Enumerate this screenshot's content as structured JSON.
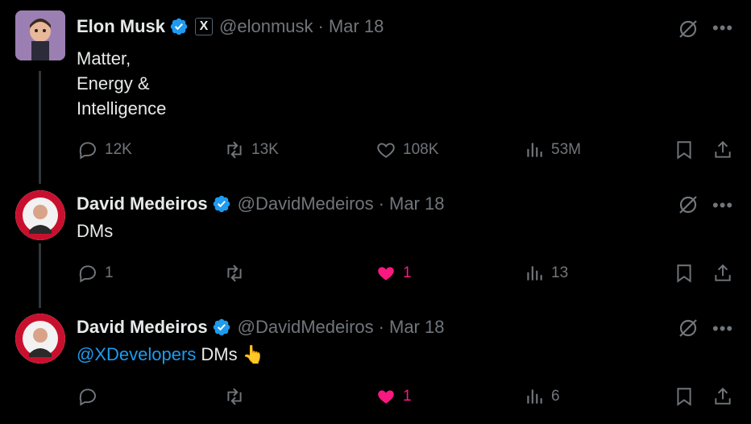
{
  "tweets": [
    {
      "name": "Elon Musk",
      "handle": "@elonmusk",
      "sep": "·",
      "date": "Mar 18",
      "affiliate": "X",
      "lines": [
        "Matter,",
        "Energy &",
        "Intelligence"
      ],
      "replies": "12K",
      "retweets": "13K",
      "likes": "108K",
      "views": "53M"
    },
    {
      "name": "David Medeiros",
      "handle": "@DavidMedeiros",
      "sep": "·",
      "date": "Mar 18",
      "text": "DMs",
      "replies": "1",
      "retweets": "",
      "likes": "1",
      "views": "13"
    },
    {
      "name": "David Medeiros",
      "handle": "@DavidMedeiros",
      "sep": "·",
      "date": "Mar 18",
      "mention": "@XDevelopers",
      "text": "DMs",
      "emoji": "👆",
      "replies": "",
      "retweets": "",
      "likes": "1",
      "views": "6"
    }
  ],
  "more_label": "•••",
  "colors": {
    "accent": "#1d9bf0",
    "like": "#f91880",
    "muted": "#71767b",
    "text": "#e7e9ea"
  },
  "icons": [
    "reply-icon",
    "retweet-icon",
    "like-icon",
    "views-icon",
    "bookmark-icon",
    "share-icon",
    "grok-icon",
    "verified-icon"
  ]
}
